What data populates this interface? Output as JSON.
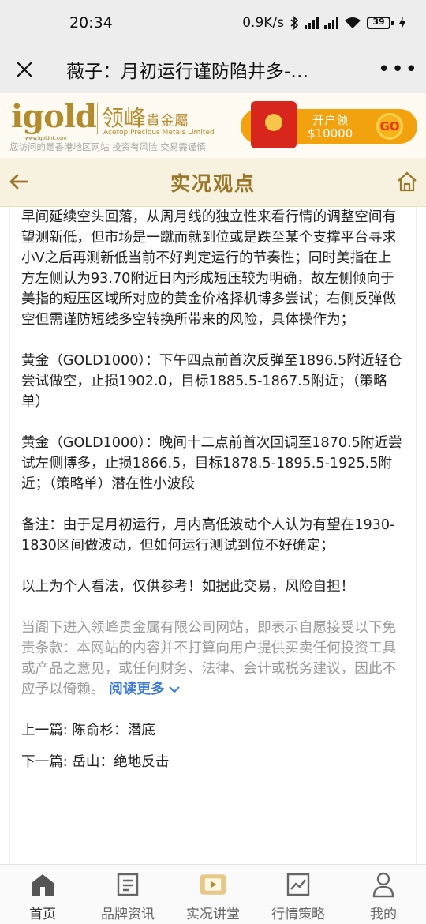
{
  "status": {
    "time": "20:34",
    "net_speed": "0.9K/s",
    "battery": "39"
  },
  "nav": {
    "title": "薇子：月初运行谨防陷井多-…",
    "more": "•••"
  },
  "banner": {
    "brand": "igold",
    "brand_url": "www.igoldhk.com",
    "brand_cn": "领峰",
    "brand_cn_small": "貴金屬",
    "brand_en": "Acetop Precious Metals Limited",
    "note": "您访问的是香港地区网站 投资有风险 交易需谨慎",
    "promo_line1": "开户领",
    "promo_line2": "$10000",
    "promo_go": "GO"
  },
  "section": {
    "title": "实况观点"
  },
  "article": {
    "paragraphs": [
      "早间延续空头回落，从周月线的独立性来看行情的调整空间有望测新低，但市场是一蹴而就到位或是跌至某个支撑平台寻求小V之后再测新低当前不好判定运行的节奏性；同时美指在上方左侧认为93.70附近日内形成短压较为明确，故左侧倾向于美指的短压区域所对应的黄金价格择机博多尝试；右侧反弹做空但需谨防短线多空转换所带来的风险，具体操作为；",
      "黄金（GOLD1000）：下午四点前首次反弹至1896.5附近轻仓尝试做空，止损1902.0，目标1885.5-1867.5附近；（策略单）",
      "黄金（GOLD1000）：晚间十二点前首次回调至1870.5附近尝试左侧博多，止损1866.5，目标1878.5-1895.5-1925.5附近；（策略单）潜在性小波段",
      "备注：由于是月初运行，月内高低波动个人认为有望在1930-1830区间做波动，但如何运行测试到位不好确定；",
      "以上为个人看法，仅供参考！如据此交易，风险自担！"
    ],
    "disclaimer": "当阁下进入领峰贵金属有限公司网站，即表示自愿接受以下免责条款：本网站的内容并不打算向用户提供买卖任何投资工具或产品之意见，或任何财务、法律、会计或税务建议，因此不应予以倚赖。",
    "read_more": "阅读更多",
    "prev": "上一篇: 陈俞杉：潜底",
    "next": "下一篇: 岳山：绝地反击"
  },
  "tabs": [
    {
      "label": "首页",
      "icon": "home-tab-icon"
    },
    {
      "label": "品牌资讯",
      "icon": "news-tab-icon"
    },
    {
      "label": "实况讲堂",
      "icon": "video-tab-icon"
    },
    {
      "label": "行情策略",
      "icon": "chart-tab-icon"
    },
    {
      "label": "我的",
      "icon": "profile-tab-icon"
    }
  ]
}
